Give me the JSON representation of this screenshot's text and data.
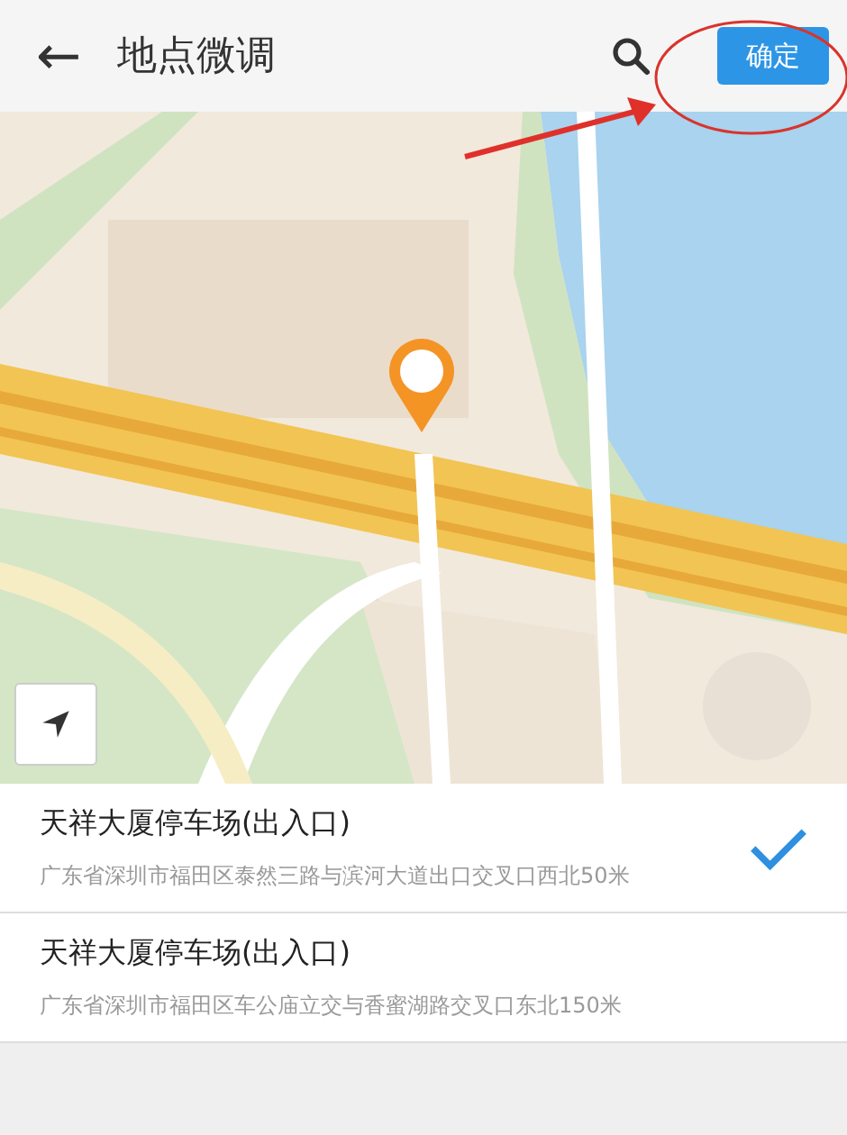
{
  "header": {
    "back": "←",
    "title": "地点微调",
    "confirm": "确定"
  },
  "places": [
    {
      "name": "天祥大厦停车场(出入口)",
      "address": "广东省深圳市福田区泰然三路与滨河大道出口交叉口西北50米",
      "selected": true
    },
    {
      "name": "天祥大厦停车场(出入口)",
      "address": "广东省深圳市福田区车公庙立交与香蜜湖路交叉口东北150米",
      "selected": false
    }
  ]
}
